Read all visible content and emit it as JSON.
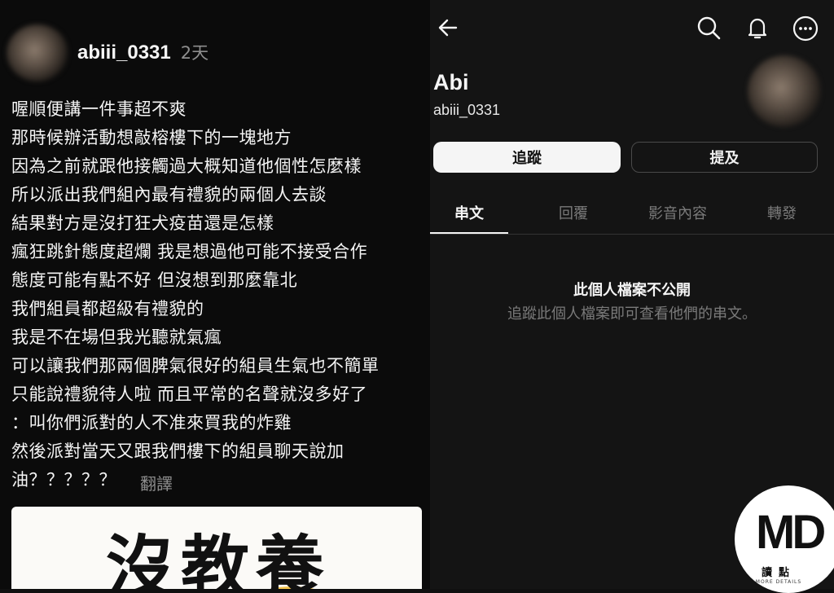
{
  "post": {
    "username": "abiii_0331",
    "time": "2天",
    "lines": [
      "喔順便講一件事超不爽",
      "那時候辦活動想敲榕樓下的一塊地方",
      "因為之前就跟他接觸過大概知道他個性怎麼樣",
      "所以派出我們組內最有禮貌的兩個人去談",
      "結果對方是沒打狂犬疫苗還是怎樣",
      "瘋狂跳針態度超爛 我是想過他可能不接受合作",
      "態度可能有點不好 但沒想到那麼靠北",
      "我們組員都超級有禮貌的",
      "我是不在場但我光聽就氣瘋",
      "可以讓我們那兩個脾氣很好的組員生氣也不簡單",
      "只能說禮貌待人啦 而且平常的名聲就沒多好了",
      "：叫你們派對的人不准來買我的炸雞",
      "然後派對當天又跟我們樓下的組員聊天說加",
      "油？？？？？"
    ],
    "translate_label": "翻譯",
    "sticker_text": "沒教養"
  },
  "profile": {
    "name": "Abi",
    "handle": "abiii_0331",
    "follow_label": "追蹤",
    "mention_label": "提及",
    "tabs": [
      "串文",
      "回覆",
      "影音內容",
      "轉發"
    ],
    "private_title": "此個人檔案不公開",
    "private_subtitle": "追蹤此個人檔案即可查看他們的串文。"
  },
  "watermark": {
    "logo_text": "MD",
    "label": "讀點",
    "sub": "MORE DETAILS"
  },
  "icons": {
    "back": "back-arrow-icon",
    "search": "search-icon",
    "notifications": "bell-icon",
    "more": "more-icon"
  }
}
